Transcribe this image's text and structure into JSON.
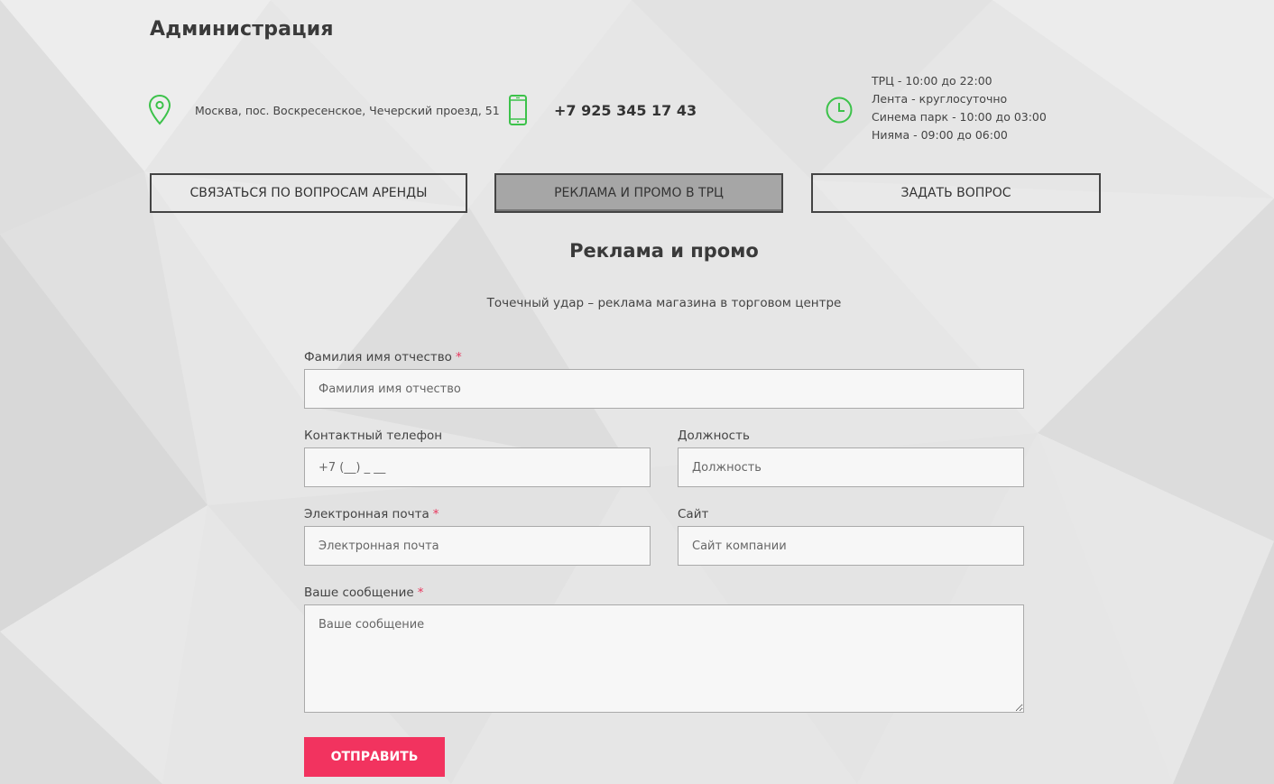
{
  "heading": "Администрация",
  "contacts": {
    "address": "Москва, пос. Воскресенское, Чечерский проезд, 51",
    "phone": "+7 925 345 17 43",
    "hours": [
      "ТРЦ - 10:00 до 22:00",
      "Лента - круглосуточно",
      "Синема парк - 10:00 до 03:00",
      "Нияма - 09:00 до 06:00"
    ]
  },
  "tabs": [
    {
      "label": "Связаться по вопросам аренды"
    },
    {
      "label": "Реклама и промо в ТРЦ"
    },
    {
      "label": "Задать вопрос"
    }
  ],
  "form": {
    "title": "Реклама и промо",
    "subtitle": "Точечный удар – реклама магазина в торговом центре",
    "fio": {
      "label": "Фамилия имя отчество",
      "required_mark": "*",
      "placeholder": "Фамилия имя отчество"
    },
    "phone": {
      "label": "Контактный телефон",
      "placeholder": "+7 (__) _ __"
    },
    "position": {
      "label": "Должность",
      "placeholder": "Должность"
    },
    "email": {
      "label": "Электронная почта",
      "required_mark": "*",
      "placeholder": "Электронная почта"
    },
    "site": {
      "label": "Сайт",
      "placeholder": "Сайт компании"
    },
    "message": {
      "label": "Ваше сообщение",
      "required_mark": "*",
      "placeholder": "Ваше сообщение"
    },
    "submit_label": "Отправить"
  },
  "colors": {
    "accent_green": "#3cc24a",
    "submit_pink": "#f2335f",
    "required_red": "#e8365d"
  }
}
